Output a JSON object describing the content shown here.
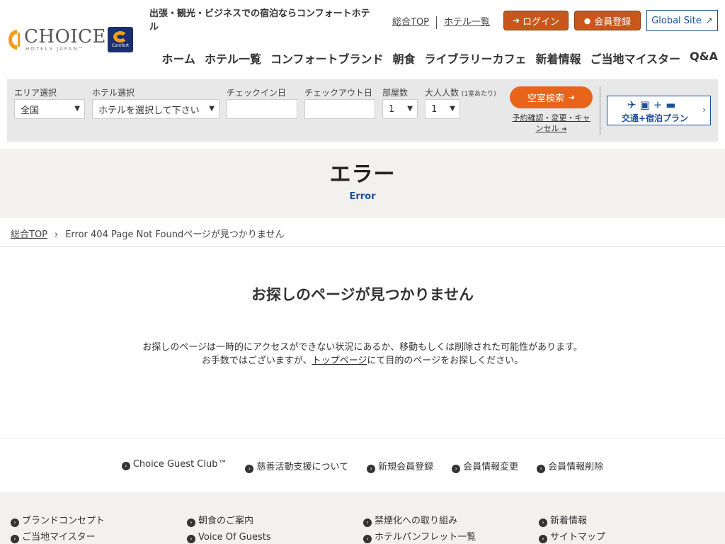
{
  "header": {
    "logo_text": "CHOICE",
    "logo_sub": "HOTELS JAPAN™",
    "comfort_badge": "Comfort",
    "tagline": "出張・観光・ビジネスでの宿泊ならコンフォートホテル",
    "top_links": [
      "総合TOP",
      "ホテル一覧"
    ],
    "login": "ログイン",
    "register": "会員登録",
    "global": "Global Site",
    "nav": [
      "ホーム",
      "ホテル一覧",
      "コンフォートブランド",
      "朝食",
      "ライブラリーカフェ",
      "新着情報",
      "ご当地マイスター",
      "Q&A"
    ]
  },
  "search": {
    "area_label": "エリア選択",
    "area_value": "全国",
    "hotel_label": "ホテル選択",
    "hotel_value": "ホテルを選択して下さい",
    "checkin_label": "チェックイン日",
    "checkout_label": "チェックアウト日",
    "rooms_label": "部屋数",
    "rooms_value": "1",
    "adults_label": "大人人数",
    "adults_note": "(1室あたり)",
    "adults_value": "1",
    "search_button": "空室検索",
    "reserve_link": "予約確認・変更・キャンセル",
    "plan_button": "交通+宿泊プラン"
  },
  "page": {
    "title": "エラー",
    "subtitle": "Error",
    "breadcrumb_top": "総合TOP",
    "breadcrumb_current": "Error 404 Page Not Foundページが見つかりません",
    "heading": "お探しのページが見つかりません",
    "msg_line1": "お探しのページは一時的にアクセスができない状況にあるか、移動もしくは削除された可能性があります。",
    "msg_line2_a": "お手数ではございますが、",
    "msg_line2_link": "トップページ",
    "msg_line2_b": "にて目的のページをお探しください。"
  },
  "footer": {
    "nav": [
      "Choice Guest Club™",
      "慈善活動支援について",
      "新規会員登録",
      "会員情報変更",
      "会員情報削除"
    ],
    "col1": [
      "ブランドコンセプト",
      "ご当地マイスター"
    ],
    "col2": [
      "朝食のご案内",
      "Voice Of Guests"
    ],
    "col3": [
      "禁煙化への取り組み",
      "ホテルパンフレット一覧"
    ],
    "col4": [
      "新着情報",
      "サイトマップ"
    ]
  },
  "colors": {
    "orange": "#e8641a",
    "brand_blue": "#1b4f9c",
    "navy": "#1b2f6e"
  }
}
